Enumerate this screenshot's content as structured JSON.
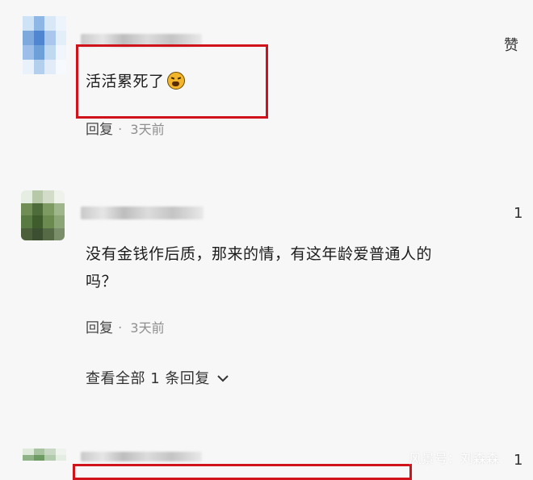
{
  "comments": [
    {
      "text": "活活累死了",
      "emoji_icon": "crying-face-emoji",
      "like_label": "赞",
      "reply_label": "回复",
      "time": "3天前"
    },
    {
      "text_line1": "没有金钱作后质，那来的情，有这年龄爱普通人的",
      "text_line2": "吗？",
      "like_count": "1",
      "reply_label": "回复",
      "time": "3天前",
      "expand_label": "查看全部 1 条回复"
    },
    {
      "like_count": "1"
    }
  ],
  "watermark": "风景号：刘森森",
  "colors": {
    "highlight_box": "#d0121b",
    "background": "#f7f7f7"
  }
}
